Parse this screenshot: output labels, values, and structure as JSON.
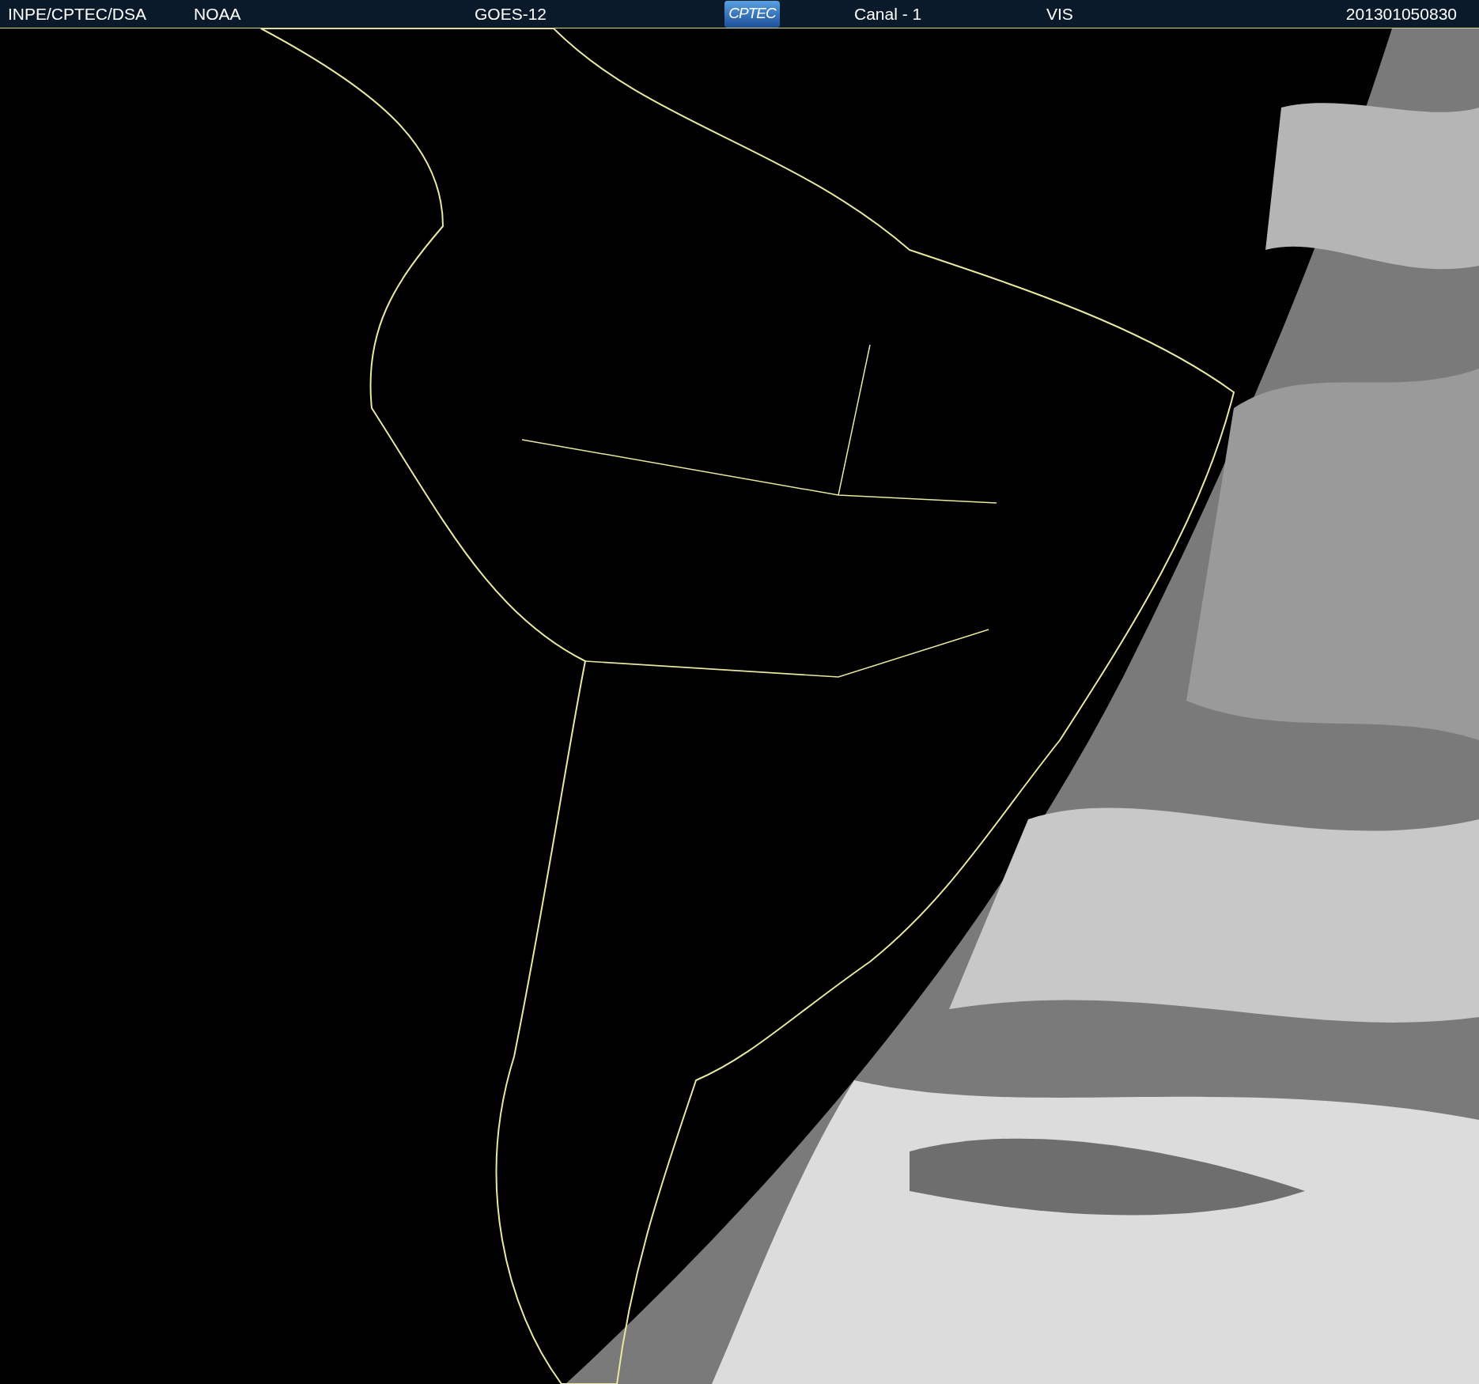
{
  "header": {
    "items": [
      {
        "kind": "text",
        "text": "INPE/CPTEC/DSA"
      },
      {
        "kind": "text",
        "text": "NOAA"
      },
      {
        "kind": "text",
        "text": "GOES-12"
      },
      {
        "kind": "logo",
        "text": "CPTEC"
      },
      {
        "kind": "text",
        "text": "Canal - 1"
      },
      {
        "kind": "text",
        "text": "VIS"
      },
      {
        "kind": "text",
        "text": "201301050830"
      }
    ]
  }
}
